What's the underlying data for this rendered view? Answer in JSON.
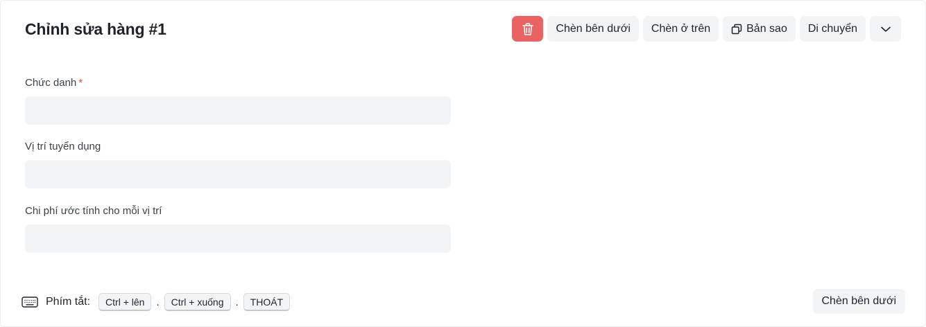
{
  "header": {
    "title": "Chỉnh sửa hàng #1"
  },
  "toolbar": {
    "delete_icon": "trash-icon",
    "insert_below_label": "Chèn bên dưới",
    "insert_above_label": "Chèn ở trên",
    "duplicate_icon": "copy-icon",
    "duplicate_label": "Bản sao",
    "move_label": "Di chuyển",
    "more_icon": "chevron-down-icon"
  },
  "form": {
    "fields": [
      {
        "label": "Chức danh",
        "required_mark": "*",
        "value": ""
      },
      {
        "label": "Vị trí tuyển dụng",
        "value": ""
      },
      {
        "label": "Chi phí ước tính cho mỗi vị trí",
        "value": ""
      }
    ]
  },
  "footer": {
    "keyboard_icon": "keyboard-icon",
    "shortcuts_label": "Phím tắt:",
    "shortcuts": [
      "Ctrl + lên",
      "Ctrl + xuống",
      "THOÁT"
    ],
    "separator": ".",
    "insert_below_label": "Chèn bên dưới"
  },
  "colors": {
    "delete_button": "#e96363",
    "button_background": "#f3f4f6",
    "required_mark": "#e24c4c"
  }
}
